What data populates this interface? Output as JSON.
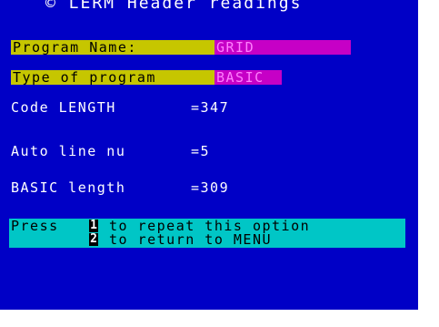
{
  "header": {
    "title": "© LERM Header readings"
  },
  "fields": {
    "program_name_label": "Program Name:",
    "program_name_value": "GRID",
    "type_label": "Type of program",
    "type_value": "BASIC"
  },
  "info": {
    "code_length_label": "Code LENGTH",
    "code_length_value": "=347",
    "auto_line_label": "Auto line nu",
    "auto_line_value": "=5",
    "basic_length_label": "BASIC length",
    "basic_length_value": "=309"
  },
  "menu": {
    "press_label": "Press",
    "key_repeat": "1",
    "repeat_text": "to repeat this option",
    "key_menu": "2",
    "menu_text": "to return to MENU"
  },
  "colors": {
    "screen_bg": "#0000c6",
    "label_yellow": "#c6c600",
    "value_magenta": "#c600c6",
    "menu_cyan": "#00c6c6"
  }
}
